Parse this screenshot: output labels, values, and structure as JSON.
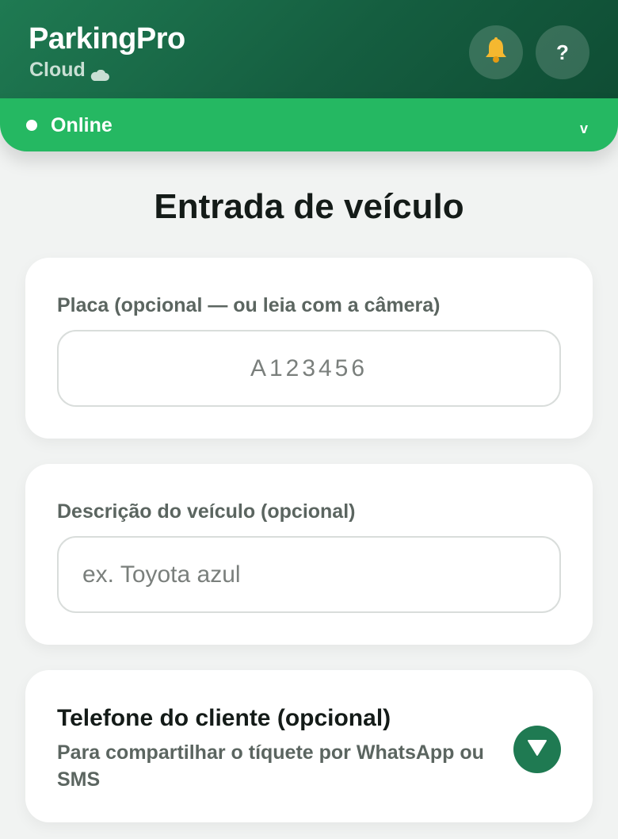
{
  "header": {
    "title": "ParkingPro",
    "subtitle": "Cloud",
    "subtitle_icon": "cloud-icon",
    "notifications_icon": "bell-icon",
    "help_label": "?"
  },
  "status": {
    "label": "Online",
    "toggle_label": "v"
  },
  "page": {
    "title": "Entrada de veículo"
  },
  "plate": {
    "label": "Placa (opcional — ou leia com a câmera)",
    "placeholder": "A123456",
    "value": ""
  },
  "description": {
    "label": "Descrição do veículo (opcional)",
    "placeholder": "ex. Toyota azul",
    "value": ""
  },
  "phone": {
    "title": "Telefone do cliente (opcional)",
    "subtitle": "Para compartilhar o tíquete por WhatsApp ou SMS",
    "expand_icon": "triangle-down-icon"
  },
  "colors": {
    "brand_dark": "#155e40",
    "status_green": "#25b862",
    "accent_button": "#1f7a52",
    "bell": "#f5b830"
  }
}
